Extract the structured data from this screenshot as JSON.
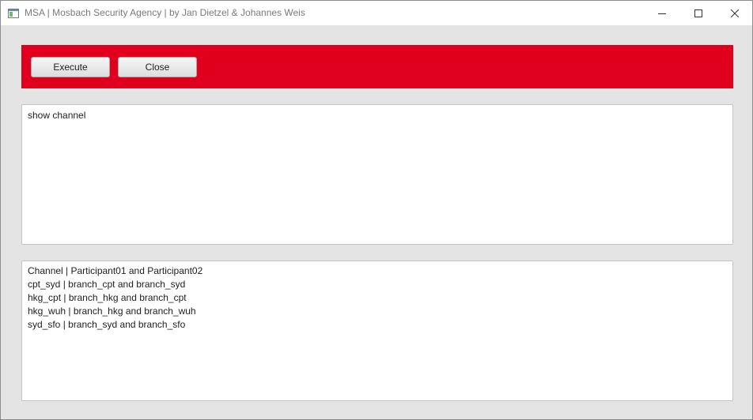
{
  "window": {
    "title": "MSA | Mosbach Security Agency | by Jan Dietzel & Johannes Weis"
  },
  "toolbar": {
    "background_color": "#e0001e",
    "execute_label": "Execute",
    "close_label": "Close"
  },
  "input": {
    "value": "show channel"
  },
  "output": {
    "lines": [
      "Channel | Participant01 and Participant02",
      "cpt_syd | branch_cpt and branch_syd",
      "hkg_cpt | branch_hkg and branch_cpt",
      "hkg_wuh | branch_hkg and branch_wuh",
      "syd_sfo | branch_syd and branch_sfo"
    ]
  }
}
